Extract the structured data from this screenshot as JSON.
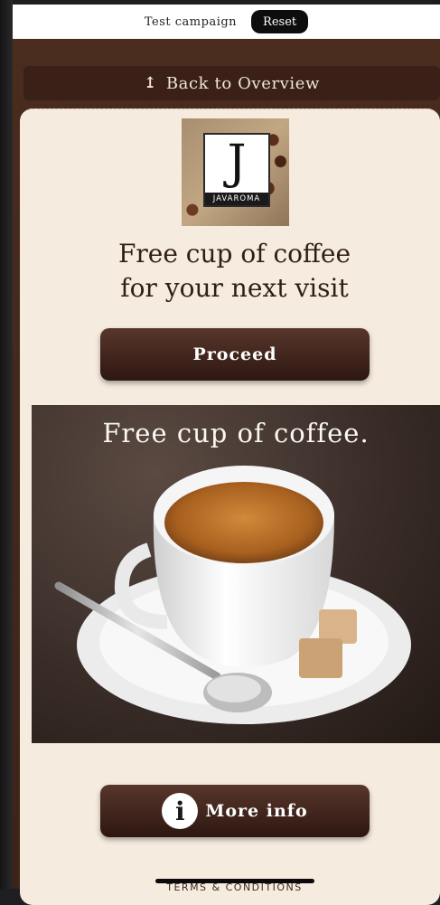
{
  "topbar": {
    "campaign_label": "Test campaign",
    "reset_label": "Reset"
  },
  "nav": {
    "back_icon": "upload-arrow-icon",
    "back_label": "Back to Overview"
  },
  "logo": {
    "letter": "J",
    "brand": "JAVAROMA"
  },
  "offer": {
    "headline_line1": "Free cup of coffee",
    "headline_line2": "for your next visit",
    "proceed_label": "Proceed"
  },
  "hero": {
    "title": "Free cup of coffee."
  },
  "more_info": {
    "icon_glyph": "i",
    "label": "More info"
  },
  "footer": {
    "terms_label": "TERMS & CONDITIONS"
  },
  "colors": {
    "accent": "#4a2c1f",
    "card": "#f6ebdf",
    "button": "#3d2218"
  }
}
